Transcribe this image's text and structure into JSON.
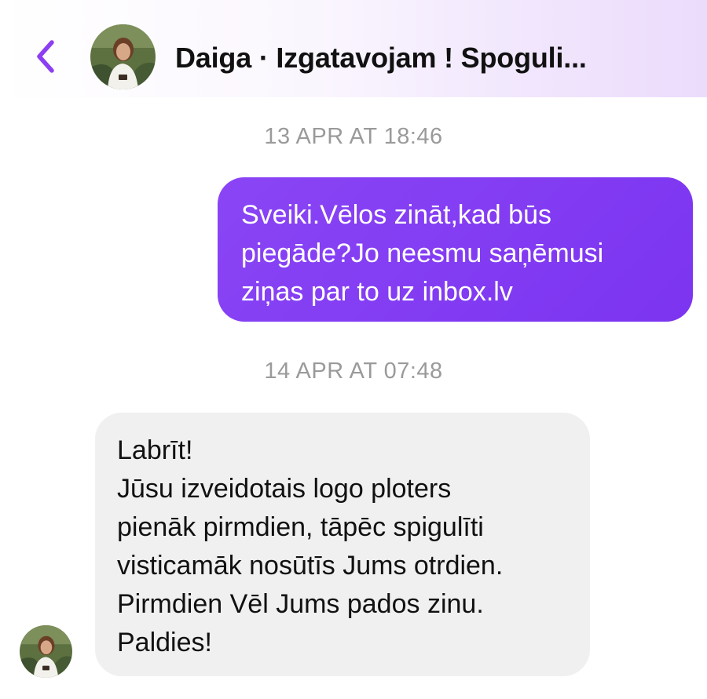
{
  "header": {
    "title": "Daiga · Izgatavojam ! Spoguli...",
    "back_icon": "chevron-left-icon",
    "accent_color": "#8c3ff2"
  },
  "messages": [
    {
      "timestamp": "13 APR AT 18:46",
      "direction": "outgoing",
      "lines": [
        "Sveiki.Vēlos zināt,kad būs",
        "piegāde?Jo neesmu saņēmusi",
        "ziņas par to uz inbox.lv"
      ]
    },
    {
      "timestamp": "14 APR AT 07:48",
      "direction": "incoming",
      "lines": [
        "Labrīt!",
        "Jūsu izveidotais logo ploters",
        "pienāk pirmdien, tāpēc spigulīti",
        "visticamāk nosūtīs Jums otrdien.",
        "Pirmdien Vēl Jums pados zinu.",
        "Paldies!"
      ]
    }
  ],
  "colors": {
    "outgoing_bubble": "#8440f4",
    "incoming_bubble": "#f0f0f1",
    "timestamp_text": "#9a9a9a"
  }
}
